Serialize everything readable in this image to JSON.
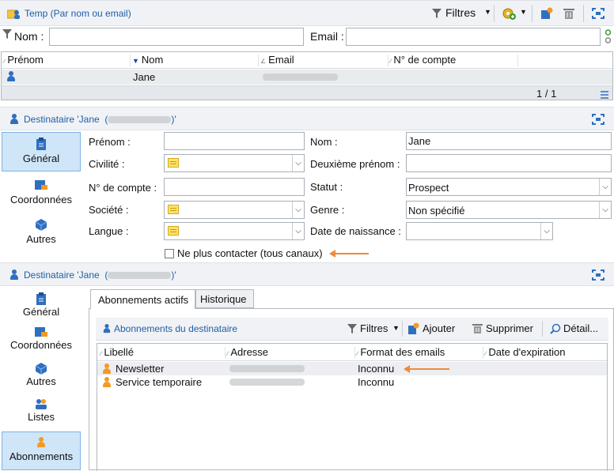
{
  "top": {
    "title": "Temp (Par nom ou email)",
    "filters_label": "Filtres",
    "search": {
      "nom_label": "Nom :",
      "nom_value": "",
      "email_label": "Email :",
      "email_value": ""
    },
    "columns": [
      "Prénom",
      "Nom",
      "Email",
      "N° de compte"
    ],
    "rows": [
      {
        "prenom": "",
        "nom": "Jane",
        "email": "jane@gmail.com",
        "compte": ""
      }
    ],
    "pagination": "1 / 1"
  },
  "recipient1": {
    "title_prefix": "Destinataire 'Jane  (",
    "title_email": "jane@gmail.com",
    "title_suffix": ")'",
    "nav": [
      {
        "label": "Général"
      },
      {
        "label": "Coordonnées"
      },
      {
        "label": "Autres"
      }
    ],
    "form": {
      "prenom_label": "Prénom :",
      "prenom_value": "",
      "nom_label": "Nom :",
      "nom_value": "Jane",
      "civilite_label": "Civilité :",
      "civilite_value": "",
      "deuxieme_label": "Deuxième prénom :",
      "deuxieme_value": "",
      "compte_label": "N° de compte :",
      "compte_value": "",
      "statut_label": "Statut :",
      "statut_value": "Prospect",
      "societe_label": "Société :",
      "societe_value": "",
      "genre_label": "Genre :",
      "genre_value": "Non spécifié",
      "langue_label": "Langue :",
      "langue_value": "",
      "naissance_label": "Date de naissance :",
      "naissance_value": "",
      "contact_label": "Ne plus contacter (tous canaux)"
    }
  },
  "recipient2": {
    "title_prefix": "Destinataire 'Jane  (",
    "title_email": "jane@gmail.com",
    "title_suffix": ")'",
    "nav": [
      {
        "label": "Général"
      },
      {
        "label": "Coordonnées"
      },
      {
        "label": "Autres"
      },
      {
        "label": "Listes"
      },
      {
        "label": "Abonnements"
      }
    ],
    "tabs": [
      {
        "label": "Abonnements actifs"
      },
      {
        "label": "Historique"
      }
    ],
    "subs_title": "Abonnements du destinataire",
    "toolbar": {
      "filtres": "Filtres",
      "ajouter": "Ajouter",
      "supprimer": "Supprimer",
      "detail": "Détail..."
    },
    "columns": [
      "Libellé",
      "Adresse",
      "Format des emails",
      "Date d'expiration"
    ],
    "rows": [
      {
        "libelle": "Newsletter",
        "adresse": "jane@gmail.com",
        "format": "Inconnu",
        "expiration": ""
      },
      {
        "libelle": "Service temporaire",
        "adresse": "jane@gmail.com",
        "format": "Inconnu",
        "expiration": ""
      }
    ]
  }
}
